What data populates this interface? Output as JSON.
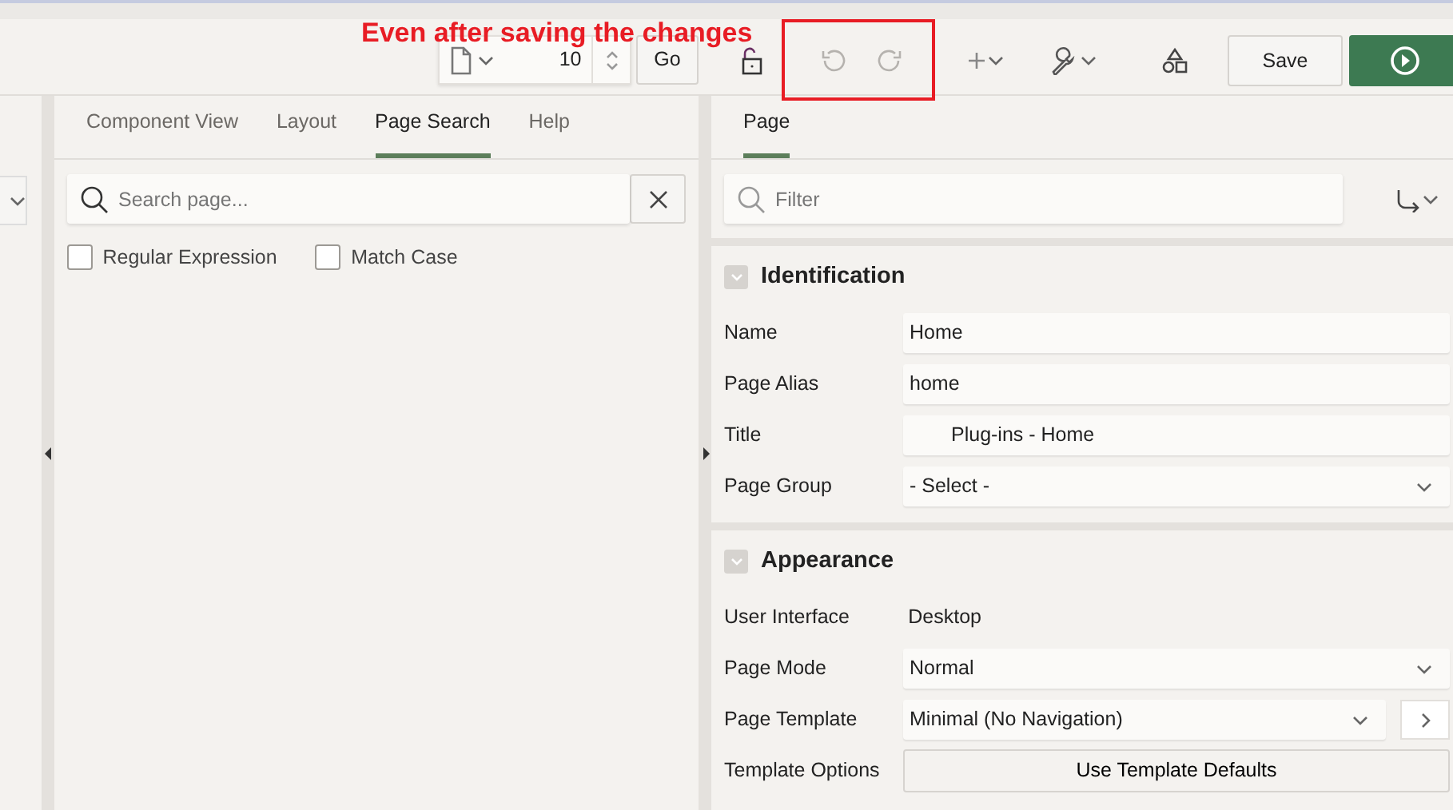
{
  "annotation": {
    "text": "Even after saving the changes"
  },
  "toolbar": {
    "page_number": "10",
    "go_button": "Go",
    "undo_disabled": true,
    "redo_disabled": true,
    "save_button": "Save"
  },
  "left_tabs": [
    {
      "label": "Component View",
      "selected": false
    },
    {
      "label": "Layout",
      "selected": false
    },
    {
      "label": "Page Search",
      "selected": true
    },
    {
      "label": "Help",
      "selected": false
    }
  ],
  "search": {
    "placeholder": "Search page..."
  },
  "options": [
    {
      "label": "Regular Expression",
      "checked": false
    },
    {
      "label": "Match Case",
      "checked": false
    }
  ],
  "right_tabs": [
    {
      "label": "Page",
      "selected": true
    }
  ],
  "filter": {
    "placeholder": "Filter"
  },
  "sections": [
    {
      "title": "Identification",
      "expanded": true,
      "properties": [
        {
          "label": "Name",
          "kind": "text",
          "value": "Home"
        },
        {
          "label": "Page Alias",
          "kind": "text",
          "value": "home"
        },
        {
          "label": "Title",
          "kind": "text",
          "value": "Plug-ins - Home"
        },
        {
          "label": "Page Group",
          "kind": "select",
          "value": "- Select -"
        }
      ]
    },
    {
      "title": "Appearance",
      "expanded": true,
      "properties": [
        {
          "label": "User Interface",
          "kind": "display",
          "value": "Desktop"
        },
        {
          "label": "Page Mode",
          "kind": "select",
          "value": "Normal"
        },
        {
          "label": "Page Template",
          "kind": "select_link",
          "value": "Minimal (No Navigation)"
        },
        {
          "label": "Template Options",
          "kind": "button",
          "value": "Use Template Defaults"
        }
      ]
    }
  ]
}
